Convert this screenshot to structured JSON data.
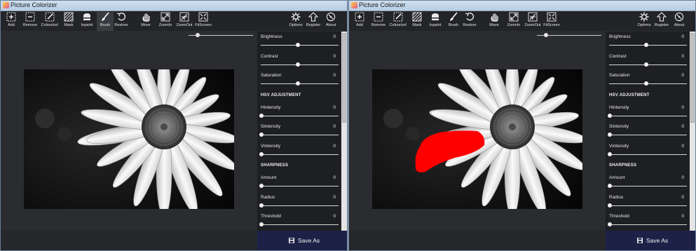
{
  "windows": [
    {
      "title": "Picture Colorizer",
      "toolbar": [
        "Add",
        "Remove",
        "Colourize!",
        "Mask",
        "Inpaint",
        "Brush",
        "Restore",
        "Move",
        "ZoomIn",
        "ZoomOut",
        "FitScreen",
        "Options",
        "Register",
        "About"
      ],
      "active_tool": "Brush",
      "panel": {
        "rows": [
          {
            "label": "Brightness",
            "value": "0",
            "level": 0.5
          },
          {
            "label": "Contrast",
            "value": "0",
            "level": 0.5
          },
          {
            "label": "Saturation",
            "value": "0",
            "level": 0.5
          },
          {
            "section": "HSV ADJUSTMENT"
          },
          {
            "label": "Hintensity",
            "value": "0",
            "level": 0.0
          },
          {
            "label": "Sintensity",
            "value": "0",
            "level": 0.0
          },
          {
            "label": "Vintensity",
            "value": "0",
            "level": 0.0
          },
          {
            "section": "SHARPNESS"
          },
          {
            "label": "Amount",
            "value": "0",
            "level": 0.0
          },
          {
            "label": "Radius",
            "value": "0",
            "level": 0.0
          },
          {
            "label": "Threshold",
            "value": "0",
            "level": 0.0
          }
        ]
      },
      "save_label": "Save As",
      "show_brush_stroke": false
    },
    {
      "title": "Picture Colorizer",
      "toolbar": [
        "Add",
        "Remove",
        "Colourize!",
        "Mask",
        "Inpaint",
        "Brush",
        "Restore",
        "Move",
        "ZoomIn",
        "ZoomOut",
        "FitScreen",
        "Options",
        "Register",
        "About"
      ],
      "active_tool": "",
      "panel": {
        "rows": [
          {
            "label": "Brightness",
            "value": "0",
            "level": 0.5
          },
          {
            "label": "Contrast",
            "value": "0",
            "level": 0.5
          },
          {
            "label": "Saturation",
            "value": "0",
            "level": 0.5
          },
          {
            "section": "HSV ADJUSTMENT"
          },
          {
            "label": "Hintensity",
            "value": "0",
            "level": 0.0
          },
          {
            "label": "Sintensity",
            "value": "0",
            "level": 0.0
          },
          {
            "label": "Vintensity",
            "value": "0",
            "level": 0.0
          },
          {
            "section": "SHARPNESS"
          },
          {
            "label": "Amount",
            "value": "0",
            "level": 0.0
          },
          {
            "label": "Radius",
            "value": "0",
            "level": 0.0
          },
          {
            "label": "Threshold",
            "value": "0",
            "level": 0.0
          }
        ]
      },
      "save_label": "Save As",
      "show_brush_stroke": true
    }
  ],
  "zoom_level": 0.12,
  "colors": {
    "brush_stroke": "#ff0000",
    "save_bar": "#1d2148",
    "panel_bg": "#1e1f22",
    "workspace_bg": "#2b2c30"
  },
  "icons": {
    "Add": "add-icon",
    "Remove": "remove-icon",
    "Colourize!": "colourize-icon",
    "Mask": "mask-icon",
    "Inpaint": "inpaint-icon",
    "Brush": "brush-icon",
    "Restore": "restore-icon",
    "Move": "move-hand-icon",
    "ZoomIn": "zoom-in-icon",
    "ZoomOut": "zoom-out-icon",
    "FitScreen": "fit-screen-icon",
    "Options": "gear-icon",
    "Register": "register-arrow-icon",
    "About": "about-icon"
  }
}
